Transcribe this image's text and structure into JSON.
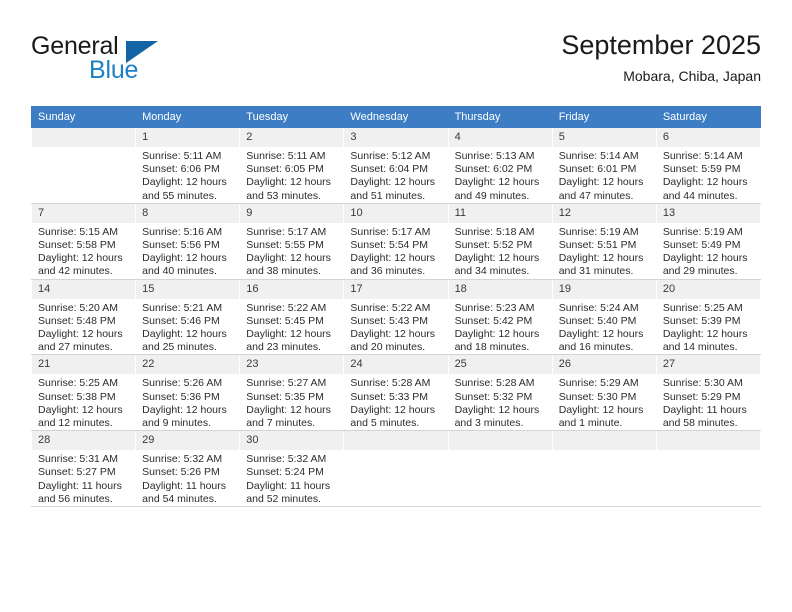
{
  "brand": {
    "name_top": "General",
    "name_bottom": "Blue",
    "logo_icon": "triangle-logo-icon"
  },
  "header": {
    "title": "September 2025",
    "location": "Mobara, Chiba, Japan"
  },
  "colors": {
    "header_row": "#3c7dc4",
    "daynum_bg": "#f0f0f0",
    "brand_blue": "#1e7fc4",
    "logo_blue": "#1464a5",
    "grid_line": "#d4d4d4"
  },
  "weekdays": [
    "Sunday",
    "Monday",
    "Tuesday",
    "Wednesday",
    "Thursday",
    "Friday",
    "Saturday"
  ],
  "weeks": [
    [
      {
        "day": "",
        "empty": true,
        "sunrise": "",
        "sunset": "",
        "daylight1": "",
        "daylight2": ""
      },
      {
        "day": "1",
        "empty": false,
        "sunrise": "Sunrise: 5:11 AM",
        "sunset": "Sunset: 6:06 PM",
        "daylight1": "Daylight: 12 hours",
        "daylight2": "and 55 minutes."
      },
      {
        "day": "2",
        "empty": false,
        "sunrise": "Sunrise: 5:11 AM",
        "sunset": "Sunset: 6:05 PM",
        "daylight1": "Daylight: 12 hours",
        "daylight2": "and 53 minutes."
      },
      {
        "day": "3",
        "empty": false,
        "sunrise": "Sunrise: 5:12 AM",
        "sunset": "Sunset: 6:04 PM",
        "daylight1": "Daylight: 12 hours",
        "daylight2": "and 51 minutes."
      },
      {
        "day": "4",
        "empty": false,
        "sunrise": "Sunrise: 5:13 AM",
        "sunset": "Sunset: 6:02 PM",
        "daylight1": "Daylight: 12 hours",
        "daylight2": "and 49 minutes."
      },
      {
        "day": "5",
        "empty": false,
        "sunrise": "Sunrise: 5:14 AM",
        "sunset": "Sunset: 6:01 PM",
        "daylight1": "Daylight: 12 hours",
        "daylight2": "and 47 minutes."
      },
      {
        "day": "6",
        "empty": false,
        "sunrise": "Sunrise: 5:14 AM",
        "sunset": "Sunset: 5:59 PM",
        "daylight1": "Daylight: 12 hours",
        "daylight2": "and 44 minutes."
      }
    ],
    [
      {
        "day": "7",
        "empty": false,
        "sunrise": "Sunrise: 5:15 AM",
        "sunset": "Sunset: 5:58 PM",
        "daylight1": "Daylight: 12 hours",
        "daylight2": "and 42 minutes."
      },
      {
        "day": "8",
        "empty": false,
        "sunrise": "Sunrise: 5:16 AM",
        "sunset": "Sunset: 5:56 PM",
        "daylight1": "Daylight: 12 hours",
        "daylight2": "and 40 minutes."
      },
      {
        "day": "9",
        "empty": false,
        "sunrise": "Sunrise: 5:17 AM",
        "sunset": "Sunset: 5:55 PM",
        "daylight1": "Daylight: 12 hours",
        "daylight2": "and 38 minutes."
      },
      {
        "day": "10",
        "empty": false,
        "sunrise": "Sunrise: 5:17 AM",
        "sunset": "Sunset: 5:54 PM",
        "daylight1": "Daylight: 12 hours",
        "daylight2": "and 36 minutes."
      },
      {
        "day": "11",
        "empty": false,
        "sunrise": "Sunrise: 5:18 AM",
        "sunset": "Sunset: 5:52 PM",
        "daylight1": "Daylight: 12 hours",
        "daylight2": "and 34 minutes."
      },
      {
        "day": "12",
        "empty": false,
        "sunrise": "Sunrise: 5:19 AM",
        "sunset": "Sunset: 5:51 PM",
        "daylight1": "Daylight: 12 hours",
        "daylight2": "and 31 minutes."
      },
      {
        "day": "13",
        "empty": false,
        "sunrise": "Sunrise: 5:19 AM",
        "sunset": "Sunset: 5:49 PM",
        "daylight1": "Daylight: 12 hours",
        "daylight2": "and 29 minutes."
      }
    ],
    [
      {
        "day": "14",
        "empty": false,
        "sunrise": "Sunrise: 5:20 AM",
        "sunset": "Sunset: 5:48 PM",
        "daylight1": "Daylight: 12 hours",
        "daylight2": "and 27 minutes."
      },
      {
        "day": "15",
        "empty": false,
        "sunrise": "Sunrise: 5:21 AM",
        "sunset": "Sunset: 5:46 PM",
        "daylight1": "Daylight: 12 hours",
        "daylight2": "and 25 minutes."
      },
      {
        "day": "16",
        "empty": false,
        "sunrise": "Sunrise: 5:22 AM",
        "sunset": "Sunset: 5:45 PM",
        "daylight1": "Daylight: 12 hours",
        "daylight2": "and 23 minutes."
      },
      {
        "day": "17",
        "empty": false,
        "sunrise": "Sunrise: 5:22 AM",
        "sunset": "Sunset: 5:43 PM",
        "daylight1": "Daylight: 12 hours",
        "daylight2": "and 20 minutes."
      },
      {
        "day": "18",
        "empty": false,
        "sunrise": "Sunrise: 5:23 AM",
        "sunset": "Sunset: 5:42 PM",
        "daylight1": "Daylight: 12 hours",
        "daylight2": "and 18 minutes."
      },
      {
        "day": "19",
        "empty": false,
        "sunrise": "Sunrise: 5:24 AM",
        "sunset": "Sunset: 5:40 PM",
        "daylight1": "Daylight: 12 hours",
        "daylight2": "and 16 minutes."
      },
      {
        "day": "20",
        "empty": false,
        "sunrise": "Sunrise: 5:25 AM",
        "sunset": "Sunset: 5:39 PM",
        "daylight1": "Daylight: 12 hours",
        "daylight2": "and 14 minutes."
      }
    ],
    [
      {
        "day": "21",
        "empty": false,
        "sunrise": "Sunrise: 5:25 AM",
        "sunset": "Sunset: 5:38 PM",
        "daylight1": "Daylight: 12 hours",
        "daylight2": "and 12 minutes."
      },
      {
        "day": "22",
        "empty": false,
        "sunrise": "Sunrise: 5:26 AM",
        "sunset": "Sunset: 5:36 PM",
        "daylight1": "Daylight: 12 hours",
        "daylight2": "and 9 minutes."
      },
      {
        "day": "23",
        "empty": false,
        "sunrise": "Sunrise: 5:27 AM",
        "sunset": "Sunset: 5:35 PM",
        "daylight1": "Daylight: 12 hours",
        "daylight2": "and 7 minutes."
      },
      {
        "day": "24",
        "empty": false,
        "sunrise": "Sunrise: 5:28 AM",
        "sunset": "Sunset: 5:33 PM",
        "daylight1": "Daylight: 12 hours",
        "daylight2": "and 5 minutes."
      },
      {
        "day": "25",
        "empty": false,
        "sunrise": "Sunrise: 5:28 AM",
        "sunset": "Sunset: 5:32 PM",
        "daylight1": "Daylight: 12 hours",
        "daylight2": "and 3 minutes."
      },
      {
        "day": "26",
        "empty": false,
        "sunrise": "Sunrise: 5:29 AM",
        "sunset": "Sunset: 5:30 PM",
        "daylight1": "Daylight: 12 hours",
        "daylight2": "and 1 minute."
      },
      {
        "day": "27",
        "empty": false,
        "sunrise": "Sunrise: 5:30 AM",
        "sunset": "Sunset: 5:29 PM",
        "daylight1": "Daylight: 11 hours",
        "daylight2": "and 58 minutes."
      }
    ],
    [
      {
        "day": "28",
        "empty": false,
        "sunrise": "Sunrise: 5:31 AM",
        "sunset": "Sunset: 5:27 PM",
        "daylight1": "Daylight: 11 hours",
        "daylight2": "and 56 minutes."
      },
      {
        "day": "29",
        "empty": false,
        "sunrise": "Sunrise: 5:32 AM",
        "sunset": "Sunset: 5:26 PM",
        "daylight1": "Daylight: 11 hours",
        "daylight2": "and 54 minutes."
      },
      {
        "day": "30",
        "empty": false,
        "sunrise": "Sunrise: 5:32 AM",
        "sunset": "Sunset: 5:24 PM",
        "daylight1": "Daylight: 11 hours",
        "daylight2": "and 52 minutes."
      },
      {
        "day": "",
        "empty": true,
        "sunrise": "",
        "sunset": "",
        "daylight1": "",
        "daylight2": ""
      },
      {
        "day": "",
        "empty": true,
        "sunrise": "",
        "sunset": "",
        "daylight1": "",
        "daylight2": ""
      },
      {
        "day": "",
        "empty": true,
        "sunrise": "",
        "sunset": "",
        "daylight1": "",
        "daylight2": ""
      },
      {
        "day": "",
        "empty": true,
        "sunrise": "",
        "sunset": "",
        "daylight1": "",
        "daylight2": ""
      }
    ]
  ]
}
